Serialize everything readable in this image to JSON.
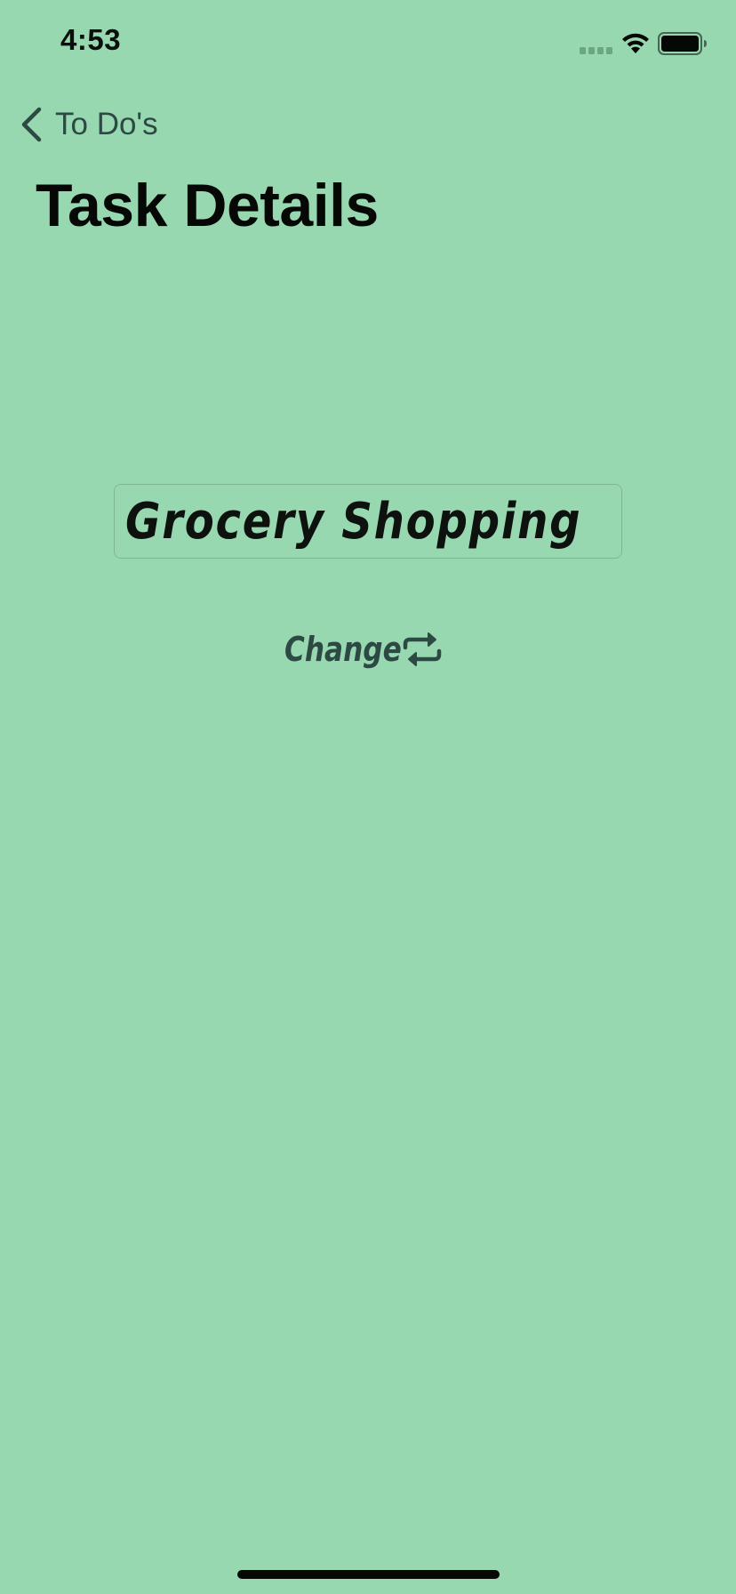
{
  "status_bar": {
    "time": "4:53"
  },
  "nav": {
    "back_label": "To Do's",
    "title": "Task Details"
  },
  "task": {
    "name": "Grocery Shopping"
  },
  "actions": {
    "change_label": "Change"
  },
  "icons": {
    "back": "chevron-left-icon",
    "change": "repeat-icon",
    "wifi": "wifi-icon",
    "battery": "battery-icon",
    "signal": "signal-icon"
  },
  "colors": {
    "background": "#98d8b1",
    "accent": "#2c4a43",
    "title": "#050805"
  }
}
